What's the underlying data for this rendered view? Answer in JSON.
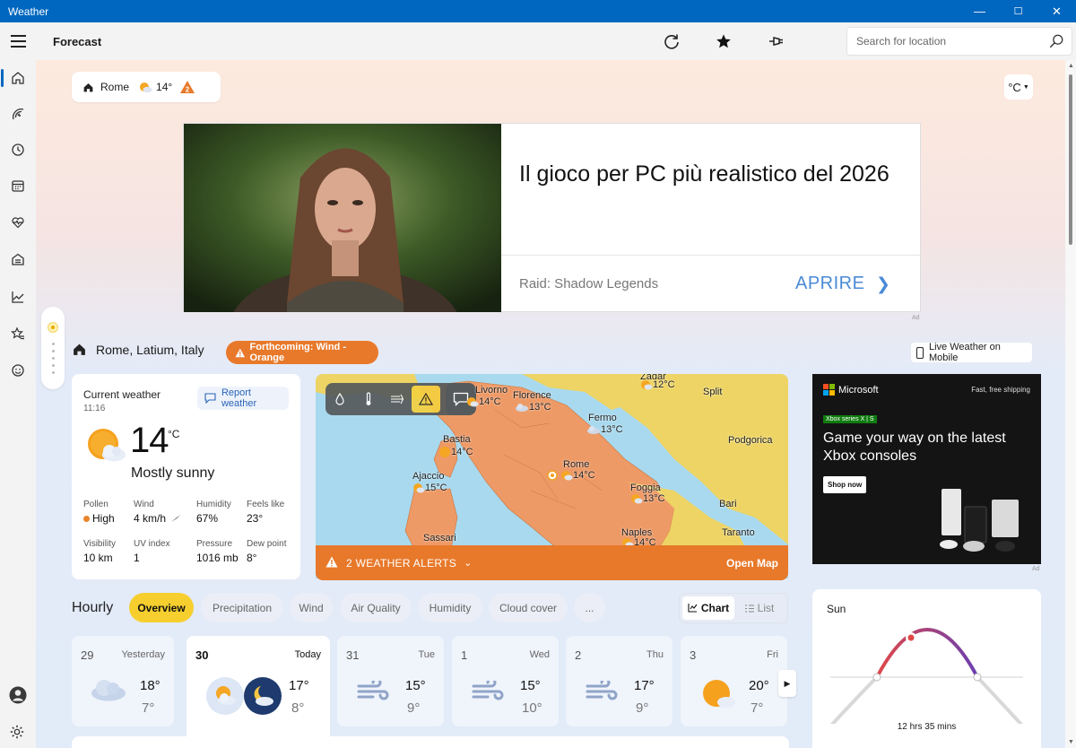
{
  "window": {
    "title": "Weather",
    "minimize": "—",
    "maximize": "☐",
    "close": "✕"
  },
  "appbar": {
    "page_title": "Forecast",
    "search_placeholder": "Search for location"
  },
  "nav": [
    "home",
    "radar",
    "history",
    "calendar",
    "health",
    "home-monitor",
    "trends",
    "favorites",
    "life"
  ],
  "location_pill": {
    "city": "Rome",
    "temp": "14°"
  },
  "unit": "°C",
  "ad_top": {
    "headline": "Il gioco per PC più realistico del 2026",
    "brand": "Raid: Shadow Legends",
    "cta": "APRIRE",
    "ad_label": "Ad"
  },
  "location": {
    "name": "Rome, Latium, Italy",
    "alert": "Forthcoming: Wind - Orange",
    "live_mobile": "Live Weather on Mobile"
  },
  "current": {
    "heading": "Current weather",
    "time": "11:16",
    "report": "Report weather",
    "temp": "14",
    "unit": "°C",
    "condition": "Mostly sunny",
    "details": [
      {
        "label": "Pollen",
        "value": "High"
      },
      {
        "label": "Wind",
        "value": "4 km/h"
      },
      {
        "label": "Humidity",
        "value": "67%"
      },
      {
        "label": "Feels like",
        "value": "23°"
      },
      {
        "label": "Visibility",
        "value": "10 km"
      },
      {
        "label": "UV index",
        "value": "1"
      },
      {
        "label": "Pressure",
        "value": "1016 mb"
      },
      {
        "label": "Dew point",
        "value": "8°"
      }
    ]
  },
  "map": {
    "cities": [
      {
        "name": "Zadar",
        "temp": "12°C"
      },
      {
        "name": "Split"
      },
      {
        "name": "Livorno",
        "temp": "14°C"
      },
      {
        "name": "Florence",
        "temp": "13°C"
      },
      {
        "name": "Fermo",
        "temp": "13°C"
      },
      {
        "name": "Podgorica"
      },
      {
        "name": "Bastia",
        "temp": "14°C"
      },
      {
        "name": "Rome",
        "temp": "14°C"
      },
      {
        "name": "Ajaccio",
        "temp": "15°C"
      },
      {
        "name": "Foggia",
        "temp": "13°C"
      },
      {
        "name": "Bari"
      },
      {
        "name": "Sassari"
      },
      {
        "name": "Naples",
        "temp": "14°C"
      },
      {
        "name": "Taranto"
      }
    ],
    "alerts_label": "2 WEATHER ALERTS",
    "open_map": "Open Map"
  },
  "ad_side": {
    "brand": "Microsoft",
    "shipping": "Fast, free shipping",
    "tag": "Xbox series X | S",
    "headline": "Game your way on the latest Xbox consoles",
    "cta": "Shop now",
    "ad_label": "Ad"
  },
  "hourly": {
    "label": "Hourly",
    "tabs": [
      "Overview",
      "Precipitation",
      "Wind",
      "Air Quality",
      "Humidity",
      "Cloud cover",
      "..."
    ],
    "view": {
      "chart": "Chart",
      "list": "List"
    }
  },
  "days": [
    {
      "num": "29",
      "name": "Yesterday",
      "hi": "18°",
      "lo": "7°",
      "icon": "cloudy-icon"
    },
    {
      "num": "30",
      "name": "Today",
      "hi": "17°",
      "lo": "8°",
      "icon": "partly-cloudy-day-night-icon"
    },
    {
      "num": "31",
      "name": "Tue",
      "hi": "15°",
      "lo": "9°",
      "icon": "windy-icon"
    },
    {
      "num": "1",
      "name": "Wed",
      "hi": "15°",
      "lo": "10°",
      "icon": "windy-icon"
    },
    {
      "num": "2",
      "name": "Thu",
      "hi": "17°",
      "lo": "9°",
      "icon": "windy-icon"
    },
    {
      "num": "3",
      "name": "Fri",
      "hi": "20°",
      "lo": "7°",
      "icon": "partly-sunny-icon"
    }
  ],
  "sun": {
    "label": "Sun",
    "duration": "12 hrs 35 mins"
  }
}
